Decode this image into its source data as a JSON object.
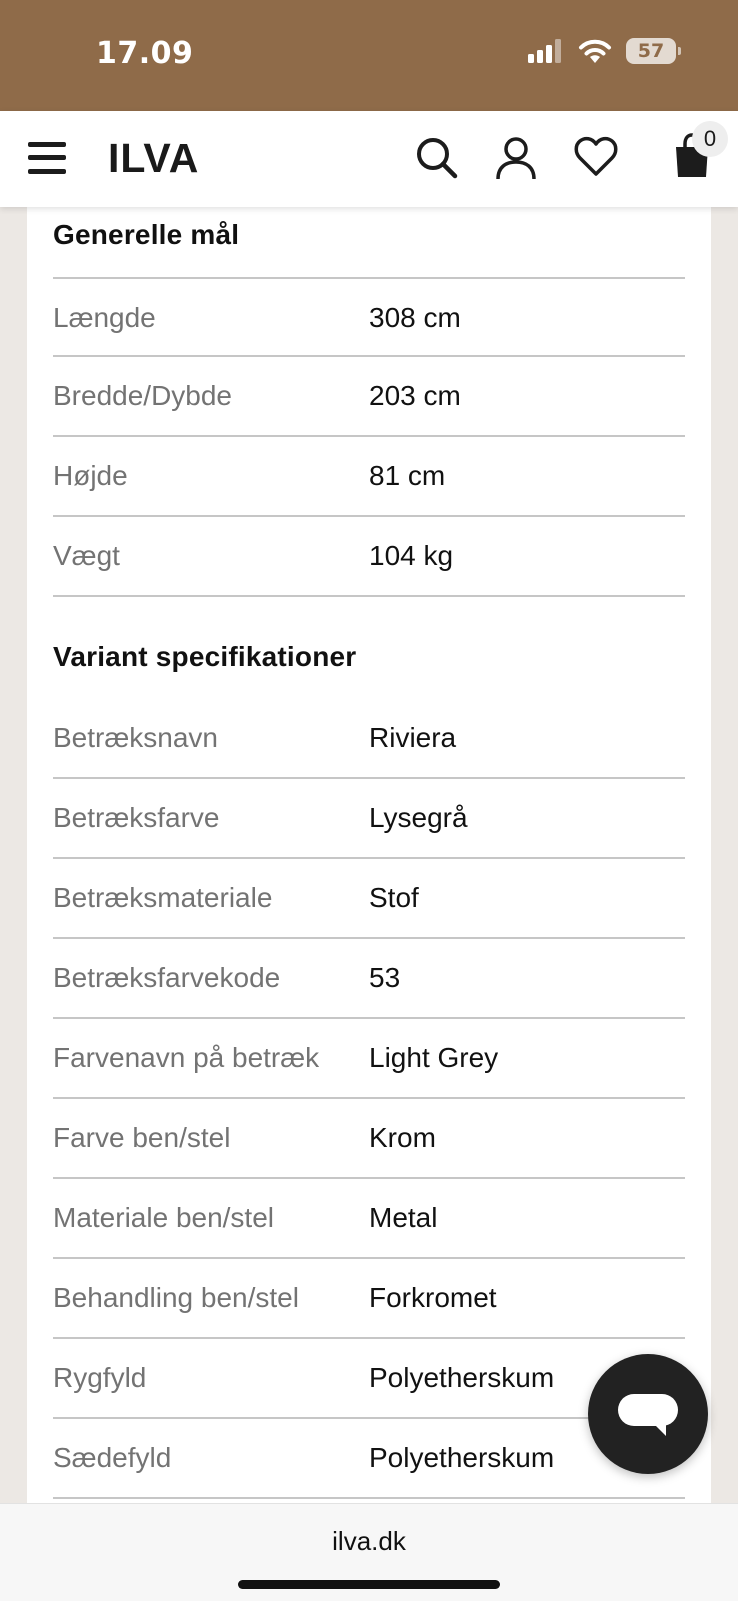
{
  "status_bar": {
    "time": "17.09",
    "battery": "57",
    "icons": [
      "cellular-signal-icon",
      "wifi-icon",
      "battery-icon"
    ],
    "background": "#8f6b49"
  },
  "header": {
    "logo": "ILVA",
    "cart_count": "0",
    "icons": [
      "menu-icon",
      "search-icon",
      "user-icon",
      "heart-icon",
      "shopping-bag-icon"
    ]
  },
  "general": {
    "title": "Generelle mål",
    "rows": [
      {
        "label": "Længde",
        "value": "308 cm"
      },
      {
        "label": "Bredde/Dybde",
        "value": "203 cm"
      },
      {
        "label": "Højde",
        "value": "81 cm"
      },
      {
        "label": "Vægt",
        "value": "104 kg"
      }
    ]
  },
  "variant": {
    "title": "Variant specifikationer",
    "rows": [
      {
        "label": "Betræksnavn",
        "value": "Riviera"
      },
      {
        "label": "Betræksfarve",
        "value": "Lysegrå"
      },
      {
        "label": "Betræksmateriale",
        "value": "Stof"
      },
      {
        "label": "Betræksfarvekode",
        "value": "53"
      },
      {
        "label": "Farvenavn på betræk",
        "value": "Light Grey"
      },
      {
        "label": "Farve ben/stel",
        "value": "Krom"
      },
      {
        "label": "Materiale ben/stel",
        "value": "Metal"
      },
      {
        "label": "Behandling ben/stel",
        "value": "Forkromet"
      },
      {
        "label": "Rygfyld",
        "value": "Polyetherskum"
      },
      {
        "label": "Sædefyld",
        "value": "Polyetherskum"
      }
    ]
  },
  "chat": {
    "icon": "chat-bubble-icon"
  },
  "browser": {
    "url": "ilva.dk"
  }
}
